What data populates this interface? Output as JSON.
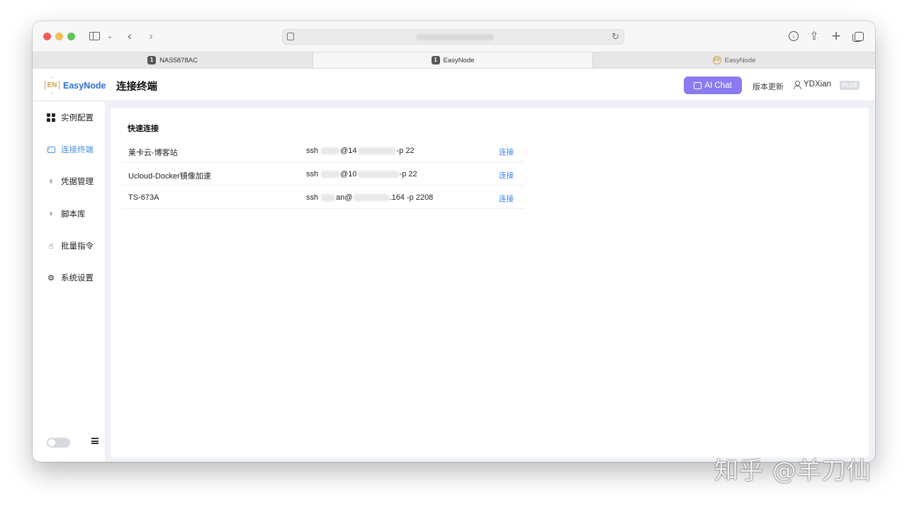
{
  "browser": {
    "tabs": [
      {
        "label": "NAS5878AC",
        "favicon": "1"
      },
      {
        "label": "EasyNode",
        "favicon": "1"
      },
      {
        "label": "EasyNode",
        "favicon": "EN"
      }
    ]
  },
  "app": {
    "logo_text": "EasyNode",
    "logo_mark": "EN",
    "page_title": "连接终端",
    "ai_chat_label": "AI Chat",
    "update_label": "版本更新",
    "username": "YDXian",
    "plus_badge": "PLUS"
  },
  "sidebar": {
    "items": [
      {
        "label": "实例配置",
        "icon": "grid-icon"
      },
      {
        "label": "连接终端",
        "icon": "terminal-icon",
        "active": true
      },
      {
        "label": "凭据管理",
        "icon": "key-icon"
      },
      {
        "label": "脚本库",
        "icon": "chevron-right-icon"
      },
      {
        "label": "批量指令",
        "icon": "pointer-icon"
      },
      {
        "label": "系统设置",
        "icon": "gear-icon"
      }
    ]
  },
  "quick_connect": {
    "title": "快速连接",
    "rows": [
      {
        "name": "莱卡云-博客站",
        "cmd_prefix": "ssh",
        "cmd_mid": "@14",
        "cmd_suffix": "-p 22",
        "action": "连接"
      },
      {
        "name": "Ucloud-Docker镜像加速",
        "cmd_prefix": "ssh",
        "cmd_mid": "@10",
        "cmd_suffix": "-p 22",
        "action": "连接"
      },
      {
        "name": "TS-673A",
        "cmd_prefix": "ssh",
        "cmd_mid": "an@",
        "cmd_suffix": ".164 -p 2208",
        "action": "连接"
      }
    ]
  },
  "watermark": "知乎 @羊刀仙",
  "colors": {
    "accent": "#8a7cf0",
    "link": "#3b82e8",
    "active_nav": "#4a8ee0",
    "logo": "#2b6fd6"
  }
}
